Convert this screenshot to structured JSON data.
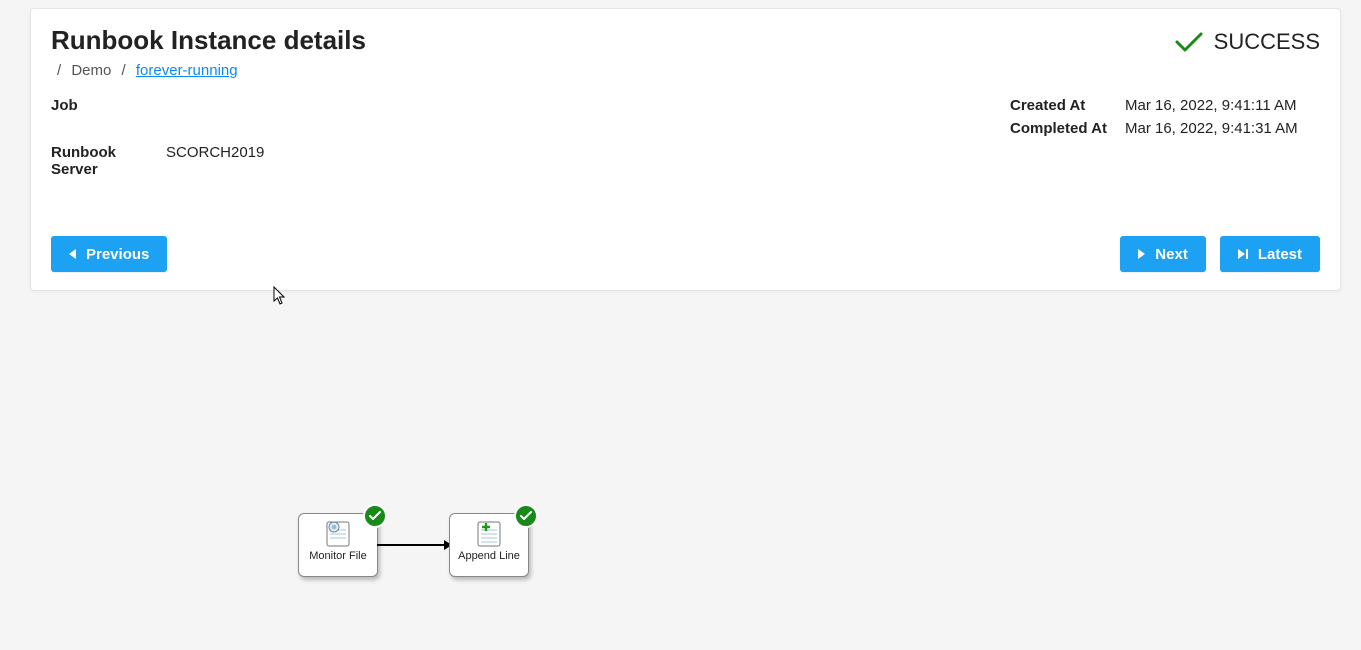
{
  "header": {
    "title": "Runbook Instance details",
    "breadcrumb": {
      "root": "Demo",
      "current": "forever-running"
    },
    "status": {
      "label": "SUCCESS",
      "color": "#188a18"
    }
  },
  "details": {
    "job_label": "Job",
    "job_value": "",
    "server_label": "Runbook Server",
    "server_value": "SCORCH2019",
    "created_label": "Created At",
    "created_value": "Mar 16, 2022, 9:41:11 AM",
    "completed_label": "Completed At",
    "completed_value": "Mar 16, 2022, 9:41:31 AM"
  },
  "buttons": {
    "previous": "Previous",
    "next": "Next",
    "latest": "Latest"
  },
  "diagram": {
    "nodes": [
      {
        "label": "Monitor File",
        "icon": "monitor-file",
        "status": "success"
      },
      {
        "label": "Append Line",
        "icon": "append-line",
        "status": "success"
      }
    ]
  },
  "colors": {
    "accent": "#1da1f2",
    "link": "#0d8af0",
    "success": "#188a18"
  }
}
